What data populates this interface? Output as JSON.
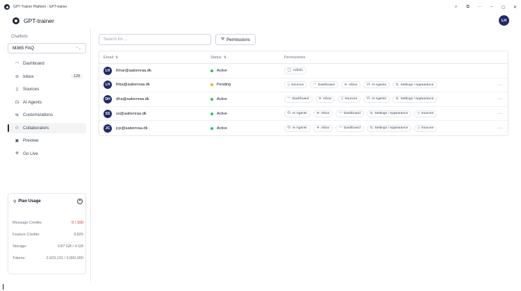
{
  "window": {
    "title": "GPT-Trainer Platform - GPT-trainer",
    "controls": {
      "zoom": "⌕",
      "sync": "⧉",
      "more": "···",
      "minimize": "–",
      "maximize": "◻",
      "close": "✕"
    }
  },
  "header": {
    "logo_text": "GPT-trainer",
    "user_initials": "LH"
  },
  "sidebar": {
    "section_label": "Chatbots",
    "selected_bot": "M365 FAQ",
    "items": [
      {
        "label": "Dashboard",
        "icon": "◠",
        "count": ""
      },
      {
        "label": "Inbox",
        "icon": "⊜",
        "count": "129"
      },
      {
        "label": "Sources",
        "icon": "▯",
        "count": ""
      },
      {
        "label": "AI Agents",
        "icon": "☊",
        "count": ""
      },
      {
        "label": "Customizations",
        "icon": "⇆",
        "count": ""
      },
      {
        "label": "Collaborators",
        "icon": "⚇",
        "count": ""
      },
      {
        "label": "Preview",
        "icon": "▣",
        "count": ""
      },
      {
        "label": "Go Live",
        "icon": "⛯",
        "count": ""
      }
    ]
  },
  "plan": {
    "title": "Plan Usage",
    "add_icon": "+",
    "rows": [
      {
        "label": "Message Credits:",
        "value": "0 / 100"
      },
      {
        "label": "Feature Credits:",
        "value": "9,825"
      },
      {
        "label": "Storage:",
        "value": "3.87 GB / 4 GB"
      },
      {
        "label": "Tokens:",
        "value": "2,923,131 / 3,000,000"
      }
    ]
  },
  "toolbar": {
    "search_placeholder": "Search for ...",
    "permissions_label": "Permissions"
  },
  "table": {
    "columns": {
      "email": "Email",
      "status": "Status",
      "permissions": "Permissions"
    },
    "rows": [
      {
        "initials": "LH",
        "email": "lhhar@aabenraa.dk",
        "status": "Active",
        "pending": false,
        "more": false,
        "perms": [
          {
            "icon": "◯",
            "label": "Admin"
          }
        ]
      },
      {
        "initials": "LH",
        "email": "lhka@aabenraa.dk",
        "status": "Pending",
        "pending": true,
        "more": true,
        "perms": [
          {
            "icon": "▯",
            "label": "Sources"
          },
          {
            "icon": "◠",
            "label": "Dashboard"
          },
          {
            "icon": "⊜",
            "label": "Inbox"
          },
          {
            "icon": "☊",
            "label": "AI Agents"
          },
          {
            "icon": "⇆",
            "label": "Settings / Appearance"
          }
        ]
      },
      {
        "initials": "DH",
        "email": "dha@aabenraa.dk",
        "status": "Active",
        "pending": false,
        "more": true,
        "perms": [
          {
            "icon": "◠",
            "label": "Dashboard"
          },
          {
            "icon": "⊜",
            "label": "Inbox"
          },
          {
            "icon": "▯",
            "label": "Sources"
          },
          {
            "icon": "☊",
            "label": "AI Agents"
          },
          {
            "icon": "⇆",
            "label": "Settings / Appearance"
          }
        ]
      },
      {
        "initials": "SS",
        "email": "ss@aabenraa.dk",
        "status": "Active",
        "pending": false,
        "more": true,
        "perms": [
          {
            "icon": "☊",
            "label": "AI Agents"
          },
          {
            "icon": "⊜",
            "label": "Inbox"
          },
          {
            "icon": "◠",
            "label": "Dashboard"
          },
          {
            "icon": "⇆",
            "label": "Settings / Appearance"
          },
          {
            "icon": "▯",
            "label": "Sources"
          }
        ]
      },
      {
        "initials": "JC",
        "email": "jcp@aabenraa.dk",
        "status": "Active",
        "pending": false,
        "more": true,
        "perms": [
          {
            "icon": "☊",
            "label": "AI Agents"
          },
          {
            "icon": "⊜",
            "label": "Inbox"
          },
          {
            "icon": "◠",
            "label": "Dashboard"
          },
          {
            "icon": "⇆",
            "label": "Settings / Appearance"
          },
          {
            "icon": "▯",
            "label": "Sources"
          }
        ]
      }
    ]
  }
}
